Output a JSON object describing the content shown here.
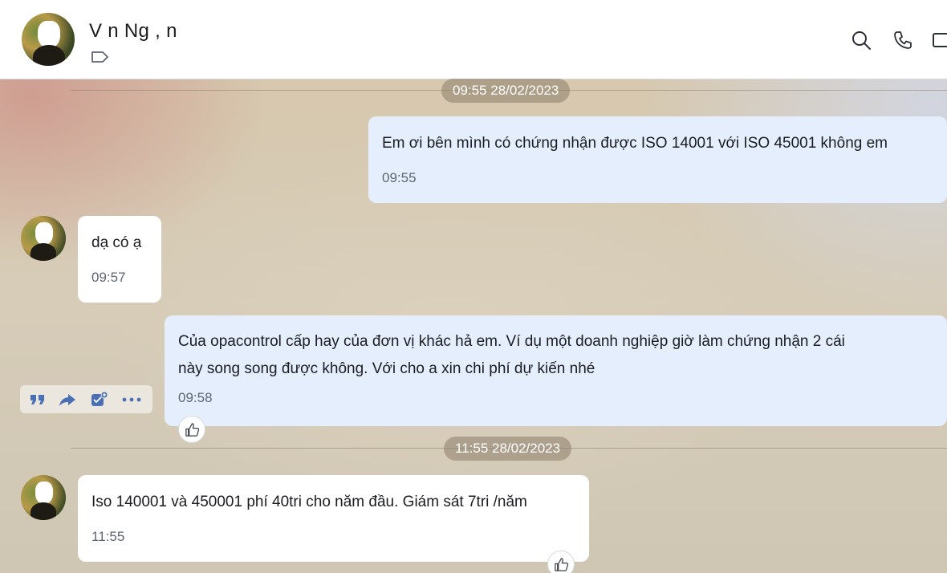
{
  "header": {
    "contact_name": "V n Ng ,  n",
    "icons": [
      "tag-icon",
      "search-icon",
      "phone-icon",
      "video-call-icon"
    ]
  },
  "dividers": [
    {
      "label": "09:55 28/02/2023"
    },
    {
      "label": "11:55 28/02/2023"
    }
  ],
  "messages": [
    {
      "direction": "sent",
      "lines": [
        "Em ơi bên mình có chứng nhận được ISO 14001 với ISO 45001 không em"
      ],
      "time": "09:55"
    },
    {
      "direction": "received",
      "lines": [
        "dạ có ạ"
      ],
      "time": "09:57"
    },
    {
      "direction": "sent",
      "lines": [
        "Của opacontrol cấp hay của đơn vị khác hả em. Ví dụ một doanh nghiệp giờ làm chứng nhận 2 cái",
        "này song song được không. Với cho a xin chi phí dự kiến nhé"
      ],
      "time": "09:58"
    },
    {
      "direction": "received",
      "lines": [
        "Iso 140001 và 450001 phí 40tri cho năm đầu. Giám sát 7tri /năm"
      ],
      "time": "11:55"
    }
  ],
  "message_actions": [
    "quote-icon",
    "forward-icon",
    "add-task-icon",
    "more-icon"
  ],
  "colors": {
    "sent_bubble": "#e4eefd",
    "received_bubble": "#ffffff",
    "date_pill": "#8c7d69",
    "text": "#1b1d21",
    "time": "#5f6672"
  }
}
